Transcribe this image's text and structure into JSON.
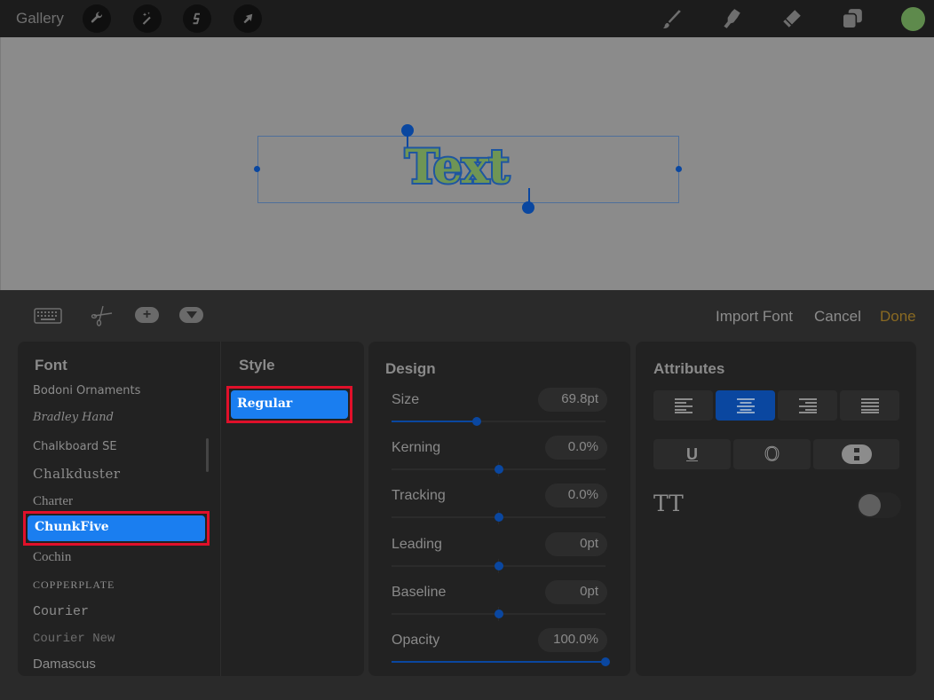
{
  "topbar": {
    "gallery_label": "Gallery",
    "left_tools": [
      {
        "name": "wrench-icon",
        "label": "Actions"
      },
      {
        "name": "magic-wand-icon",
        "label": "Adjustments"
      },
      {
        "name": "selection-s-icon",
        "label": "Selection"
      },
      {
        "name": "arrow-cursor-icon",
        "label": "Transform"
      }
    ],
    "right_tools": [
      {
        "name": "brush-icon",
        "label": "Paint"
      },
      {
        "name": "smudge-icon",
        "label": "Smudge"
      },
      {
        "name": "eraser-icon",
        "label": "Erase"
      },
      {
        "name": "layers-icon",
        "label": "Layers"
      }
    ],
    "current_color": "#5e8a4c"
  },
  "canvas": {
    "text": "Text",
    "text_fill_color": "#6f9555",
    "text_outline_color": "#1f56a0"
  },
  "panel": {
    "tools": [
      {
        "name": "keyboard-icon"
      },
      {
        "name": "scissors-icon"
      },
      {
        "name": "add-icon"
      },
      {
        "name": "dropdown-icon"
      }
    ],
    "import_font_label": "Import Font",
    "cancel_label": "Cancel",
    "done_label": "Done"
  },
  "font": {
    "title": "Font",
    "items": [
      "Bodoni Ornaments",
      "Bradley Hand",
      "Chalkboard SE",
      "Chalkduster",
      "Charter",
      "ChunkFive",
      "Cochin",
      "Copperplate",
      "Courier",
      "Courier New",
      "Damascus"
    ],
    "selected": "ChunkFive"
  },
  "style": {
    "title": "Style",
    "items": [
      "Regular"
    ],
    "selected": "Regular"
  },
  "design": {
    "title": "Design",
    "sliders": [
      {
        "label": "Size",
        "value": "69.8pt",
        "position": 0.4
      },
      {
        "label": "Kerning",
        "value": "0.0%",
        "position": 0.5
      },
      {
        "label": "Tracking",
        "value": "0.0%",
        "position": 0.5
      },
      {
        "label": "Leading",
        "value": "0pt",
        "position": 0.5
      },
      {
        "label": "Baseline",
        "value": "0pt",
        "position": 0.5
      },
      {
        "label": "Opacity",
        "value": "100.0%",
        "position": 1.0
      }
    ]
  },
  "attributes": {
    "title": "Attributes",
    "alignment": [
      "align-left",
      "align-center",
      "align-right",
      "justify"
    ],
    "alignment_selected": "align-center",
    "styles": [
      "underline",
      "outline",
      "vertical-text"
    ],
    "all_caps_label": "TT",
    "all_caps_on": false
  },
  "colors": {
    "accent": "#0a47a0",
    "selection": "#1a7ef0",
    "highlight_border": "#e0102a",
    "done": "#8a6a22"
  }
}
